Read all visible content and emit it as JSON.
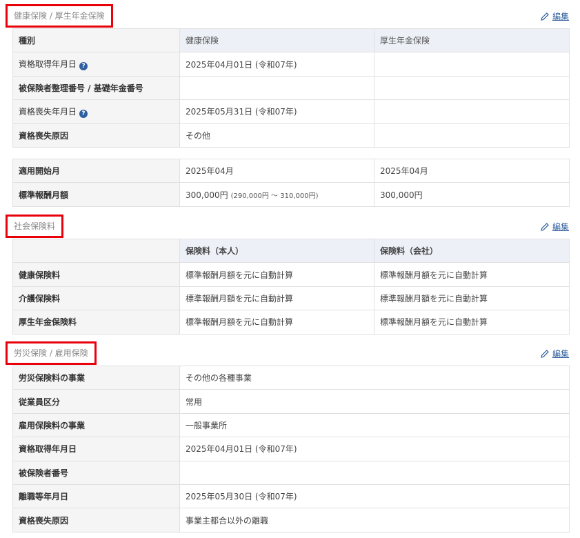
{
  "edit_label": "編集",
  "health": {
    "title": "健康保険 / 厚生年金保険",
    "header": {
      "label": "種別",
      "col1": "健康保険",
      "col2": "厚生年金保険"
    },
    "rows": [
      {
        "label": "資格取得年月日",
        "col1": "2025年04月01日 (令和07年)",
        "col2": ""
      },
      {
        "label": "被保険者整理番号 / 基礎年金番号",
        "col1": "",
        "col2": ""
      },
      {
        "label": "資格喪失年月日",
        "col1": "2025年05月31日 (令和07年)",
        "col2": ""
      },
      {
        "label": "資格喪失原因",
        "col1": "その他",
        "col2": ""
      }
    ],
    "remuneration": [
      {
        "label": "適用開始月",
        "col1": "2025年04月",
        "col1_sub": "",
        "col2": "2025年04月"
      },
      {
        "label": "標準報酬月額",
        "col1": "300,000円",
        "col1_sub": "(290,000円 ～ 310,000円)",
        "col2": "300,000円"
      }
    ]
  },
  "social": {
    "title": "社会保険料",
    "header": {
      "col1": "保険料（本人）",
      "col2": "保険料（会社）"
    },
    "rows": [
      {
        "label": "健康保険料",
        "col1": "標準報酬月額を元に自動計算",
        "col2": "標準報酬月額を元に自動計算"
      },
      {
        "label": "介護保険料",
        "col1": "標準報酬月額を元に自動計算",
        "col2": "標準報酬月額を元に自動計算"
      },
      {
        "label": "厚生年金保険料",
        "col1": "標準報酬月額を元に自動計算",
        "col2": "標準報酬月額を元に自動計算"
      }
    ]
  },
  "labor": {
    "title": "労災保険 / 雇用保険",
    "rows": [
      {
        "label": "労災保険料の事業",
        "value": "その他の各種事業"
      },
      {
        "label": "従業員区分",
        "value": "常用"
      },
      {
        "label": "雇用保険料の事業",
        "value": "一般事業所"
      },
      {
        "label": "資格取得年月日",
        "value": "2025年04月01日 (令和07年)"
      },
      {
        "label": "被保険者番号",
        "value": ""
      },
      {
        "label": "離職等年月日",
        "value": "2025年05月30日 (令和07年)"
      },
      {
        "label": "資格喪失原因",
        "value": "事業主都合以外の離職"
      }
    ]
  }
}
